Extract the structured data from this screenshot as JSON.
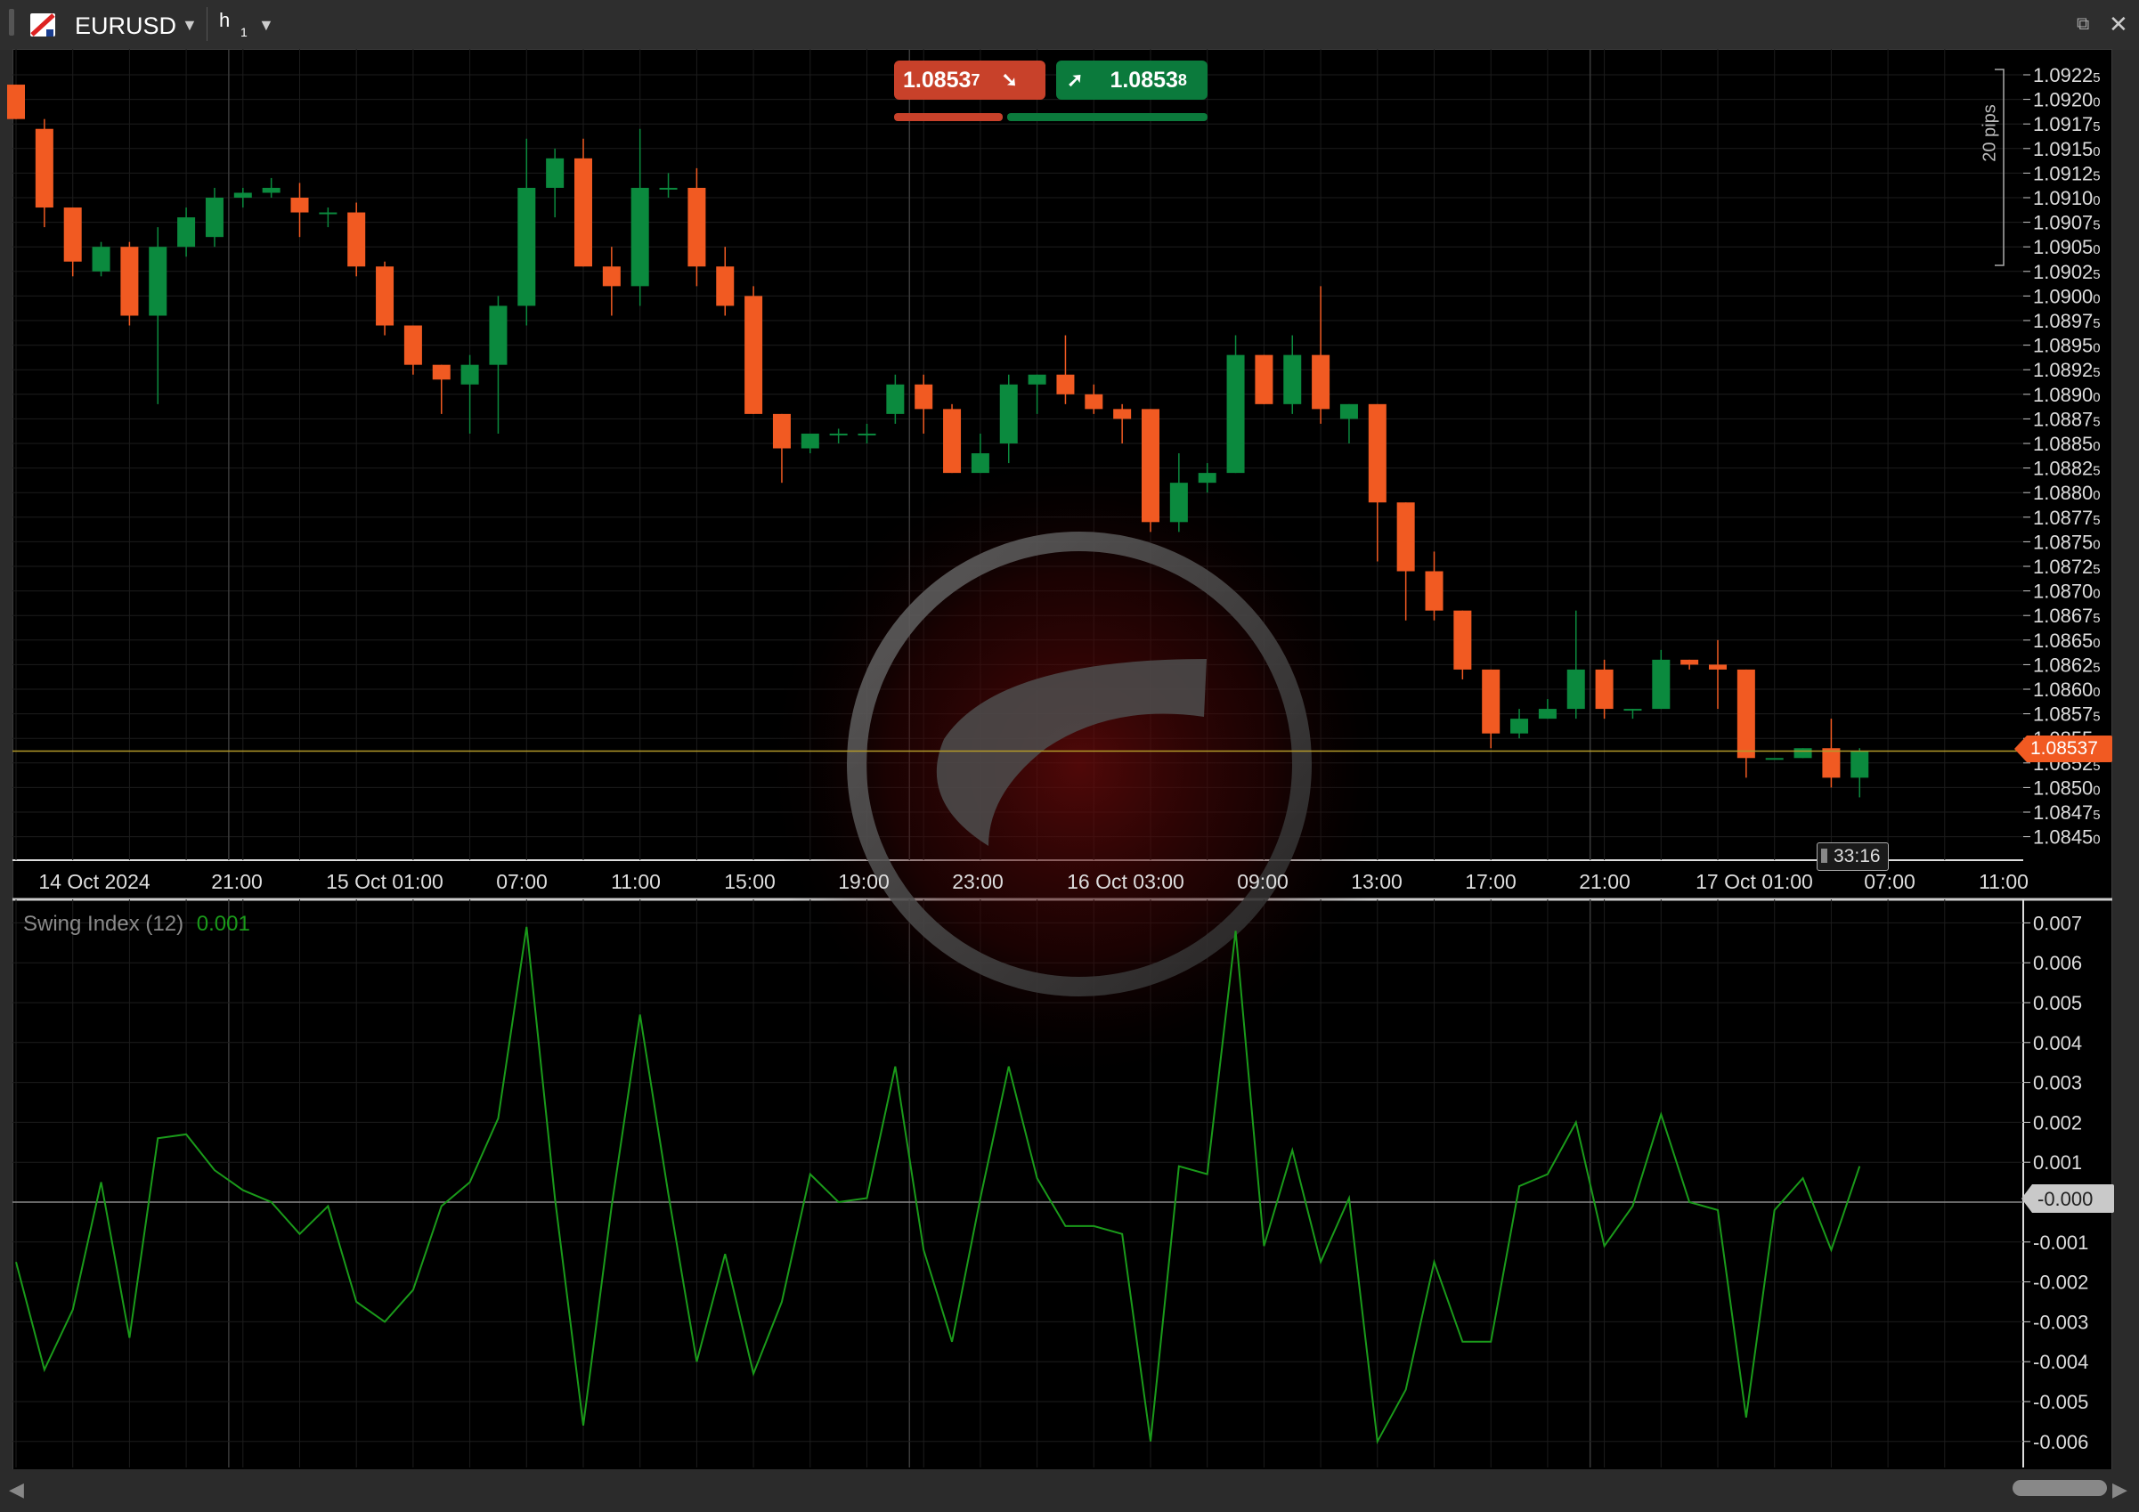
{
  "header": {
    "symbol": "EURUSD",
    "timeframe_letter": "h",
    "timeframe_number": "1"
  },
  "quote": {
    "sell_price": "1.0853",
    "sell_pip": "7",
    "buy_price": "1.0853",
    "buy_pip": "8"
  },
  "price_axis": {
    "labels": [
      {
        "v": 1.09225,
        "t": "1.0922",
        "s": "5"
      },
      {
        "v": 1.092,
        "t": "1.0920",
        "s": "0"
      },
      {
        "v": 1.09175,
        "t": "1.0917",
        "s": "5"
      },
      {
        "v": 1.0915,
        "t": "1.0915",
        "s": "0"
      },
      {
        "v": 1.09125,
        "t": "1.0912",
        "s": "5"
      },
      {
        "v": 1.091,
        "t": "1.0910",
        "s": "0"
      },
      {
        "v": 1.09075,
        "t": "1.0907",
        "s": "5"
      },
      {
        "v": 1.0905,
        "t": "1.0905",
        "s": "0"
      },
      {
        "v": 1.09025,
        "t": "1.0902",
        "s": "5"
      },
      {
        "v": 1.09,
        "t": "1.0900",
        "s": "0"
      },
      {
        "v": 1.08975,
        "t": "1.0897",
        "s": "5"
      },
      {
        "v": 1.0895,
        "t": "1.0895",
        "s": "0"
      },
      {
        "v": 1.08925,
        "t": "1.0892",
        "s": "5"
      },
      {
        "v": 1.089,
        "t": "1.0890",
        "s": "0"
      },
      {
        "v": 1.08875,
        "t": "1.0887",
        "s": "5"
      },
      {
        "v": 1.0885,
        "t": "1.0885",
        "s": "0"
      },
      {
        "v": 1.08825,
        "t": "1.0882",
        "s": "5"
      },
      {
        "v": 1.088,
        "t": "1.0880",
        "s": "0"
      },
      {
        "v": 1.08775,
        "t": "1.0877",
        "s": "5"
      },
      {
        "v": 1.0875,
        "t": "1.0875",
        "s": "0"
      },
      {
        "v": 1.08725,
        "t": "1.0872",
        "s": "5"
      },
      {
        "v": 1.087,
        "t": "1.0870",
        "s": "0"
      },
      {
        "v": 1.08675,
        "t": "1.0867",
        "s": "5"
      },
      {
        "v": 1.0865,
        "t": "1.0865",
        "s": "0"
      },
      {
        "v": 1.08625,
        "t": "1.0862",
        "s": "5"
      },
      {
        "v": 1.086,
        "t": "1.0860",
        "s": "0"
      },
      {
        "v": 1.08575,
        "t": "1.0857",
        "s": "5"
      },
      {
        "v": 1.0855,
        "t": "1.0855",
        "s": "0"
      },
      {
        "v": 1.08525,
        "t": "1.0852",
        "s": "5"
      },
      {
        "v": 1.085,
        "t": "1.0850",
        "s": "0"
      },
      {
        "v": 1.08475,
        "t": "1.0847",
        "s": "5"
      },
      {
        "v": 1.0845,
        "t": "1.0845",
        "s": "0"
      }
    ],
    "current_price": "1.08537",
    "pips_label": "20 pips",
    "countdown": "33:16"
  },
  "time_axis": {
    "labels": [
      "14 Oct 2024",
      "21:00",
      "15 Oct 01:00",
      "07:00",
      "11:00",
      "15:00",
      "19:00",
      "23:00",
      "16 Oct 03:00",
      "09:00",
      "13:00",
      "17:00",
      "21:00",
      "17 Oct 01:00",
      "07:00",
      "11:00"
    ]
  },
  "indicator": {
    "name": "Swing Index (12)",
    "value": "0.001",
    "current_value_label": "-0.000",
    "axis_labels": [
      "0.007",
      "0.006",
      "0.005",
      "0.004",
      "0.003",
      "0.002",
      "0.001",
      "-0.001",
      "-0.002",
      "-0.003",
      "-0.004",
      "-0.005",
      "-0.006"
    ]
  },
  "colors": {
    "bull": "#0b8a3e",
    "bear": "#f15a22",
    "indicator_line": "#1a9a1a",
    "current_price_line": "#b39a2a",
    "sell_box": "#c8412a",
    "buy_box": "#0b7a3c"
  },
  "chart_data": {
    "type": "candlestick",
    "interval": "1h",
    "candles": [
      {
        "o": 1.09215,
        "h": 1.09215,
        "l": 1.0918,
        "c": 1.0918
      },
      {
        "o": 1.0917,
        "h": 1.0918,
        "l": 1.0907,
        "c": 1.0909
      },
      {
        "o": 1.0909,
        "h": 1.0909,
        "l": 1.0902,
        "c": 1.09035
      },
      {
        "o": 1.09025,
        "h": 1.09055,
        "l": 1.0902,
        "c": 1.0905
      },
      {
        "o": 1.0905,
        "h": 1.09055,
        "l": 1.0897,
        "c": 1.0898
      },
      {
        "o": 1.0898,
        "h": 1.0907,
        "l": 1.0889,
        "c": 1.0905
      },
      {
        "o": 1.0905,
        "h": 1.0909,
        "l": 1.0904,
        "c": 1.0908
      },
      {
        "o": 1.0906,
        "h": 1.0911,
        "l": 1.0905,
        "c": 1.091
      },
      {
        "o": 1.091,
        "h": 1.0911,
        "l": 1.0909,
        "c": 1.09105
      },
      {
        "o": 1.09105,
        "h": 1.0912,
        "l": 1.091,
        "c": 1.0911
      },
      {
        "o": 1.091,
        "h": 1.09115,
        "l": 1.0906,
        "c": 1.09085
      },
      {
        "o": 1.09085,
        "h": 1.0909,
        "l": 1.0907,
        "c": 1.09085
      },
      {
        "o": 1.09085,
        "h": 1.09095,
        "l": 1.0902,
        "c": 1.0903
      },
      {
        "o": 1.0903,
        "h": 1.09035,
        "l": 1.0896,
        "c": 1.0897
      },
      {
        "o": 1.0897,
        "h": 1.0897,
        "l": 1.0892,
        "c": 1.0893
      },
      {
        "o": 1.0893,
        "h": 1.0893,
        "l": 1.0888,
        "c": 1.08915
      },
      {
        "o": 1.0891,
        "h": 1.0894,
        "l": 1.0886,
        "c": 1.0893
      },
      {
        "o": 1.0893,
        "h": 1.09,
        "l": 1.0886,
        "c": 1.0899
      },
      {
        "o": 1.0899,
        "h": 1.0916,
        "l": 1.0897,
        "c": 1.0911
      },
      {
        "o": 1.0911,
        "h": 1.0915,
        "l": 1.0908,
        "c": 1.0914
      },
      {
        "o": 1.0914,
        "h": 1.0916,
        "l": 1.0903,
        "c": 1.0903
      },
      {
        "o": 1.0903,
        "h": 1.0905,
        "l": 1.0898,
        "c": 1.0901
      },
      {
        "o": 1.0901,
        "h": 1.0917,
        "l": 1.0899,
        "c": 1.0911
      },
      {
        "o": 1.0911,
        "h": 1.09125,
        "l": 1.091,
        "c": 1.0911
      },
      {
        "o": 1.0911,
        "h": 1.0913,
        "l": 1.0901,
        "c": 1.0903
      },
      {
        "o": 1.0903,
        "h": 1.0905,
        "l": 1.0898,
        "c": 1.0899
      },
      {
        "o": 1.09,
        "h": 1.0901,
        "l": 1.0888,
        "c": 1.0888
      },
      {
        "o": 1.0888,
        "h": 1.0888,
        "l": 1.0881,
        "c": 1.08845
      },
      {
        "o": 1.08845,
        "h": 1.0886,
        "l": 1.0884,
        "c": 1.0886
      },
      {
        "o": 1.0886,
        "h": 1.08865,
        "l": 1.0885,
        "c": 1.0886
      },
      {
        "o": 1.0886,
        "h": 1.0887,
        "l": 1.0885,
        "c": 1.0886
      },
      {
        "o": 1.0888,
        "h": 1.0892,
        "l": 1.0887,
        "c": 1.0891
      },
      {
        "o": 1.0891,
        "h": 1.0892,
        "l": 1.0886,
        "c": 1.08885
      },
      {
        "o": 1.08885,
        "h": 1.0889,
        "l": 1.0882,
        "c": 1.0882
      },
      {
        "o": 1.0882,
        "h": 1.0886,
        "l": 1.0882,
        "c": 1.0884
      },
      {
        "o": 1.0885,
        "h": 1.0892,
        "l": 1.0883,
        "c": 1.0891
      },
      {
        "o": 1.0891,
        "h": 1.0892,
        "l": 1.0888,
        "c": 1.0892
      },
      {
        "o": 1.0892,
        "h": 1.0896,
        "l": 1.0889,
        "c": 1.089
      },
      {
        "o": 1.089,
        "h": 1.0891,
        "l": 1.0888,
        "c": 1.08885
      },
      {
        "o": 1.08885,
        "h": 1.0889,
        "l": 1.0885,
        "c": 1.08875
      },
      {
        "o": 1.08885,
        "h": 1.08885,
        "l": 1.0876,
        "c": 1.0877
      },
      {
        "o": 1.0877,
        "h": 1.0884,
        "l": 1.0876,
        "c": 1.0881
      },
      {
        "o": 1.0881,
        "h": 1.0883,
        "l": 1.088,
        "c": 1.0882
      },
      {
        "o": 1.0882,
        "h": 1.0896,
        "l": 1.0882,
        "c": 1.0894
      },
      {
        "o": 1.0894,
        "h": 1.0894,
        "l": 1.0889,
        "c": 1.0889
      },
      {
        "o": 1.0889,
        "h": 1.0896,
        "l": 1.0888,
        "c": 1.0894
      },
      {
        "o": 1.0894,
        "h": 1.0901,
        "l": 1.0887,
        "c": 1.08885
      },
      {
        "o": 1.08875,
        "h": 1.0889,
        "l": 1.0885,
        "c": 1.0889
      },
      {
        "o": 1.0889,
        "h": 1.0889,
        "l": 1.0873,
        "c": 1.0879
      },
      {
        "o": 1.0879,
        "h": 1.0879,
        "l": 1.0867,
        "c": 1.0872
      },
      {
        "o": 1.0872,
        "h": 1.0874,
        "l": 1.0867,
        "c": 1.0868
      },
      {
        "o": 1.0868,
        "h": 1.0868,
        "l": 1.0861,
        "c": 1.0862
      },
      {
        "o": 1.0862,
        "h": 1.0862,
        "l": 1.0854,
        "c": 1.08555
      },
      {
        "o": 1.08555,
        "h": 1.0858,
        "l": 1.0855,
        "c": 1.0857
      },
      {
        "o": 1.0857,
        "h": 1.0859,
        "l": 1.0857,
        "c": 1.0858
      },
      {
        "o": 1.0858,
        "h": 1.0868,
        "l": 1.0857,
        "c": 1.0862
      },
      {
        "o": 1.0862,
        "h": 1.0863,
        "l": 1.0857,
        "c": 1.0858
      },
      {
        "o": 1.0858,
        "h": 1.0858,
        "l": 1.0857,
        "c": 1.0858
      },
      {
        "o": 1.0858,
        "h": 1.0864,
        "l": 1.0858,
        "c": 1.0863
      },
      {
        "o": 1.0863,
        "h": 1.0863,
        "l": 1.0862,
        "c": 1.08625
      },
      {
        "o": 1.08625,
        "h": 1.0865,
        "l": 1.0858,
        "c": 1.0862
      },
      {
        "o": 1.0862,
        "h": 1.0862,
        "l": 1.0851,
        "c": 1.0853
      },
      {
        "o": 1.0853,
        "h": 1.0853,
        "l": 1.0853,
        "c": 1.0853
      },
      {
        "o": 1.0853,
        "h": 1.0854,
        "l": 1.0853,
        "c": 1.0854
      },
      {
        "o": 1.0854,
        "h": 1.0857,
        "l": 1.085,
        "c": 1.0851
      },
      {
        "o": 1.0851,
        "h": 1.0854,
        "l": 1.0849,
        "c": 1.08537
      }
    ],
    "swing_index": [
      -0.0015,
      -0.0042,
      -0.0027,
      0.0005,
      -0.0034,
      0.0016,
      0.0017,
      0.0008,
      0.0003,
      0.0,
      -0.0008,
      -0.0001,
      -0.0025,
      -0.003,
      -0.0022,
      -0.0001,
      0.0005,
      0.0021,
      0.0069,
      0.0001,
      -0.0056,
      -0.0001,
      0.0047,
      0.0002,
      -0.004,
      -0.0013,
      -0.0043,
      -0.0025,
      0.0007,
      0.0,
      0.0001,
      0.0034,
      -0.0012,
      -0.0035,
      0.0001,
      0.0034,
      0.0006,
      -0.0006,
      -0.0006,
      -0.0008,
      -0.006,
      0.0009,
      0.0007,
      0.0068,
      -0.0011,
      0.0013,
      -0.0015,
      0.0001,
      -0.006,
      -0.0047,
      -0.0015,
      -0.0035,
      -0.0035,
      0.0004,
      0.0007,
      0.002,
      -0.0011,
      -0.0001,
      0.0022,
      0.0,
      -0.0002,
      -0.0054,
      -0.0002,
      0.0006,
      -0.0012,
      0.0009
    ]
  }
}
